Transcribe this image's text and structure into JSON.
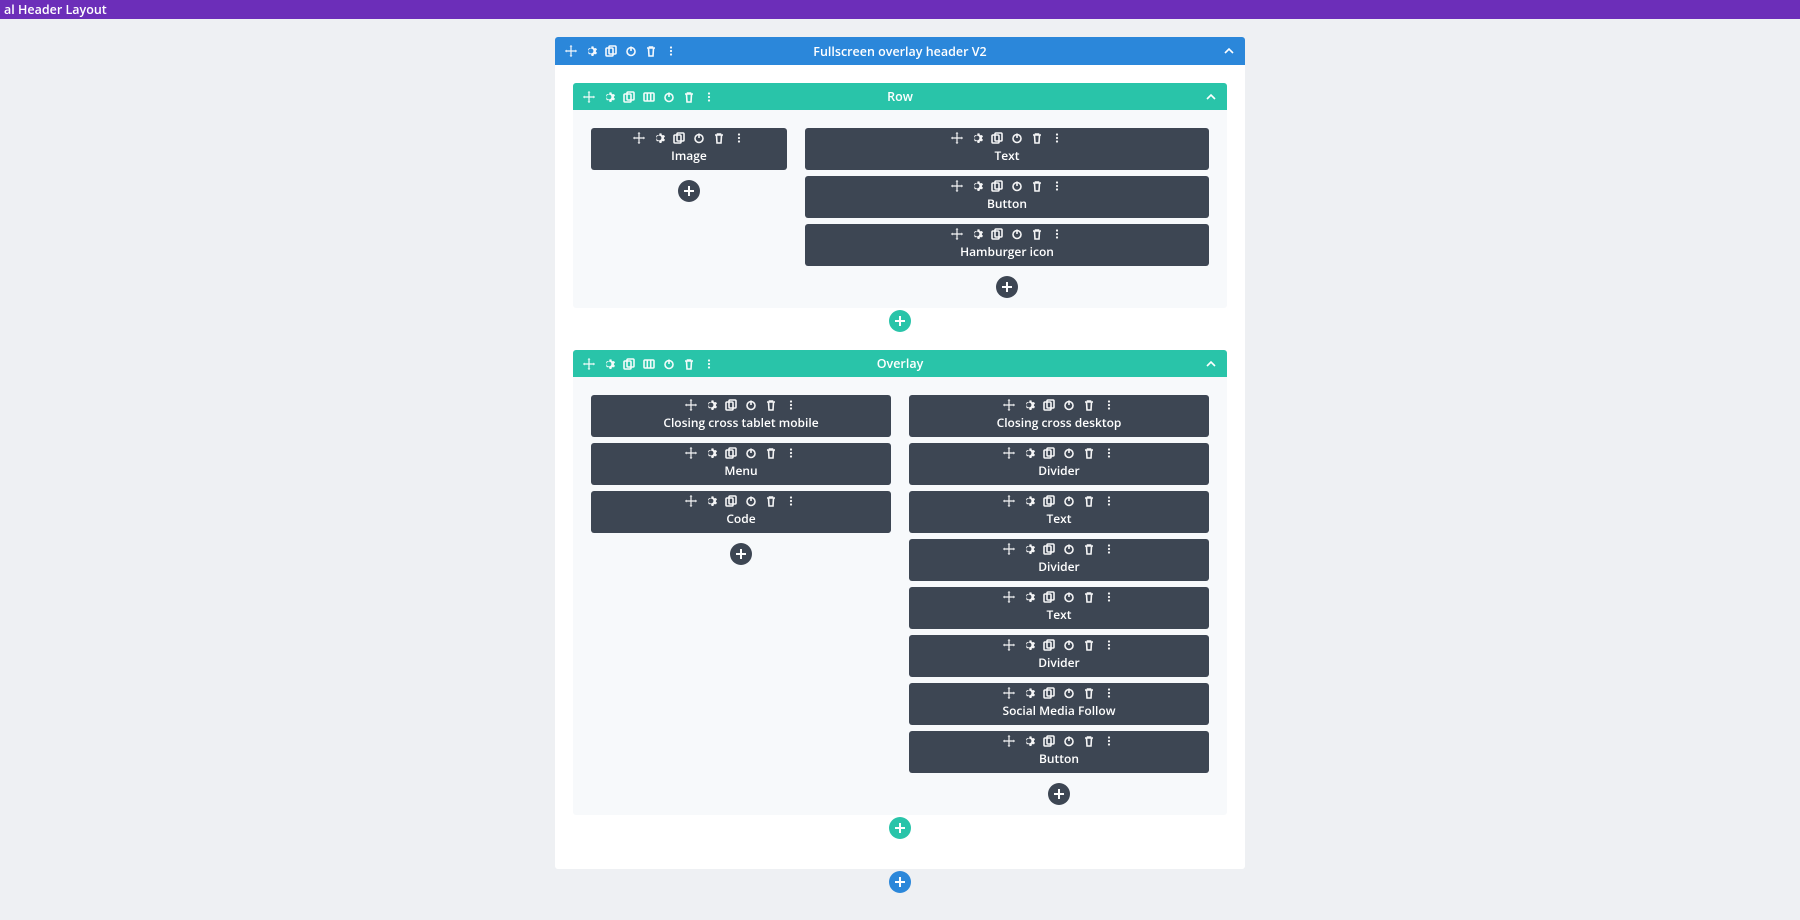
{
  "topbar": {
    "title": "al Header Layout"
  },
  "section": {
    "title": "Fullscreen overlay header V2",
    "rows": [
      {
        "title": "Row",
        "columns": [
          {
            "type": "narrow",
            "modules": [
              "Image"
            ]
          },
          {
            "type": "wide",
            "modules": [
              "Text",
              "Button",
              "Hamburger icon"
            ]
          }
        ]
      },
      {
        "title": "Overlay",
        "columns": [
          {
            "type": "half",
            "modules": [
              "Closing cross tablet mobile",
              "Menu",
              "Code"
            ]
          },
          {
            "type": "half",
            "modules": [
              "Closing cross desktop",
              "Divider",
              "Text",
              "Divider",
              "Text",
              "Divider",
              "Social Media Follow",
              "Button"
            ]
          }
        ]
      }
    ]
  },
  "icons": {
    "move": "move-icon",
    "settings": "gear-icon",
    "duplicate": "duplicate-icon",
    "columns": "columns-icon",
    "power": "power-icon",
    "delete": "trash-icon",
    "more": "more-icon",
    "collapse": "chevron-up-icon",
    "add": "plus-icon"
  }
}
